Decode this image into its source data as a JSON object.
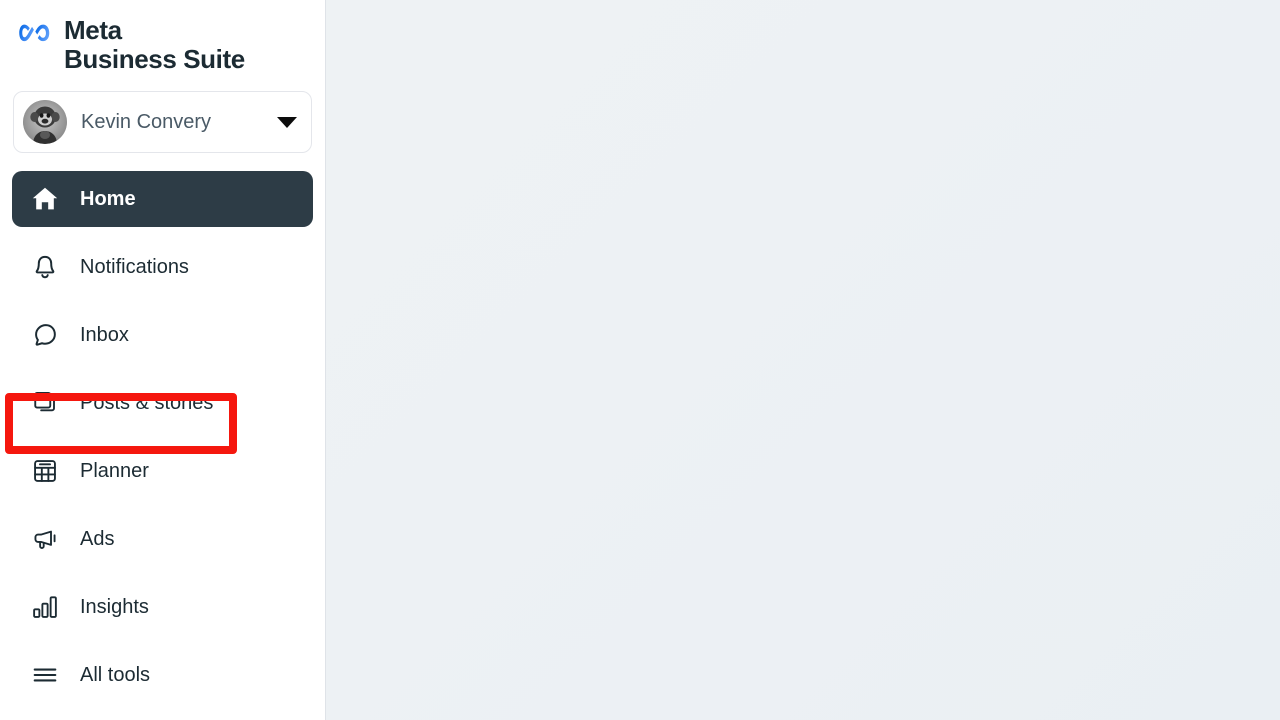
{
  "app": {
    "brand_line1": "Meta",
    "brand_line2": "Business Suite",
    "logo_icon": "meta-infinity-logo"
  },
  "account": {
    "name": "Kevin Convery",
    "avatar_icon": "user-avatar-photo",
    "caret_icon": "chevron-down-icon"
  },
  "sidebar": {
    "items": [
      {
        "label": "Home",
        "icon": "home-icon",
        "active": true,
        "key": "home"
      },
      {
        "label": "Notifications",
        "icon": "bell-icon",
        "active": false,
        "key": "notifications"
      },
      {
        "label": "Inbox",
        "icon": "chat-bubble-icon",
        "active": false,
        "key": "inbox"
      },
      {
        "label": "Posts & stories",
        "icon": "stacked-cards-icon",
        "active": false,
        "key": "posts-and-stories"
      },
      {
        "label": "Planner",
        "icon": "calendar-grid-icon",
        "active": false,
        "key": "planner"
      },
      {
        "label": "Ads",
        "icon": "megaphone-icon",
        "active": false,
        "key": "ads"
      },
      {
        "label": "Insights",
        "icon": "bar-chart-icon",
        "active": false,
        "key": "insights"
      },
      {
        "label": "All tools",
        "icon": "hamburger-menu-icon",
        "active": false,
        "key": "all-tools"
      }
    ]
  },
  "highlight": {
    "target_label": "Posts & stories",
    "color": "#f5170e"
  },
  "colors": {
    "brand_blue": "#1877f2",
    "active_nav_bg": "#2d3c46",
    "sidebar_bg": "#ffffff",
    "main_bg": "#eef2f4",
    "text_primary": "#1c2b33",
    "text_secondary": "#4a5a66",
    "highlight_red": "#f5170e"
  },
  "main": {
    "content": ""
  }
}
